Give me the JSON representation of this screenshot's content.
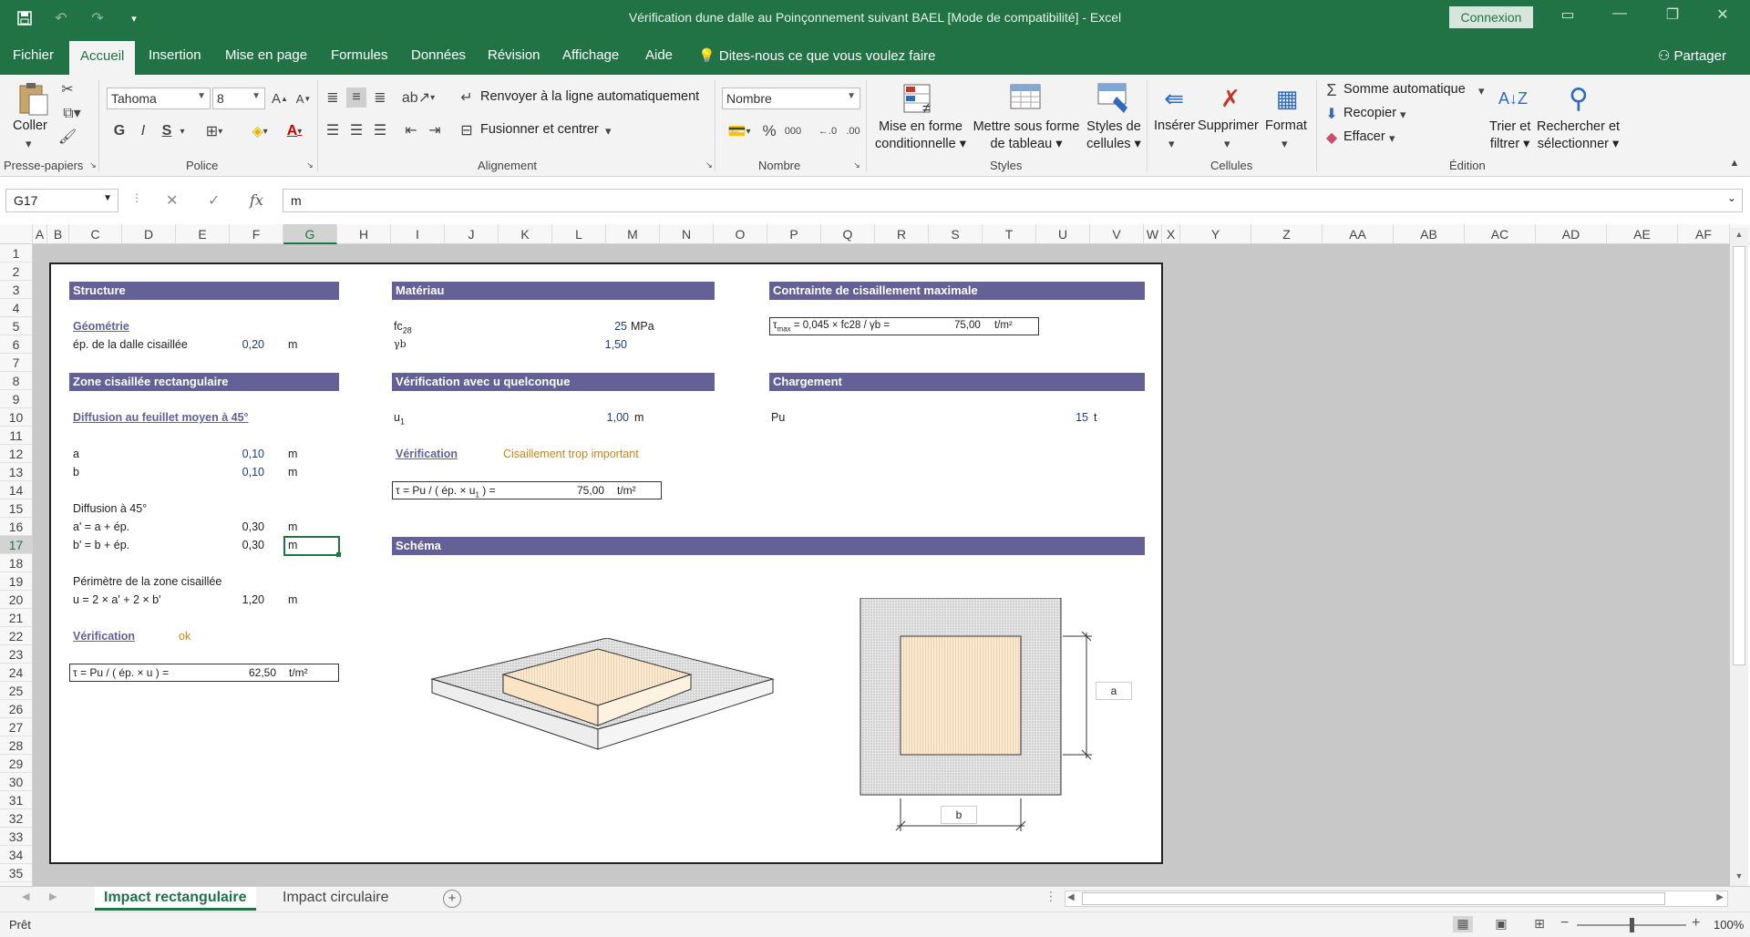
{
  "window": {
    "title": "Vérification dune dalle au Poinçonnement suivant BAEL  [Mode de compatibilité]  -  Excel",
    "signin": "Connexion"
  },
  "menu": {
    "items": [
      "Fichier",
      "Accueil",
      "Insertion",
      "Mise en page",
      "Formules",
      "Données",
      "Révision",
      "Affichage",
      "Aide"
    ],
    "tell_me": "Dites-nous ce que vous voulez faire",
    "share": "Partager"
  },
  "ribbon": {
    "paste": "Coller",
    "font_name": "Tahoma",
    "font_size": "8",
    "bold": "G",
    "italic": "I",
    "underline": "S",
    "wrap_text": "Renvoyer à la ligne automatiquement",
    "merge_center": "Fusionner et centrer",
    "number_format": "Nombre",
    "cond_format": [
      "Mise en forme",
      "conditionnelle"
    ],
    "format_table": [
      "Mettre sous forme",
      "de tableau"
    ],
    "cell_styles": [
      "Styles de",
      "cellules"
    ],
    "insert": "Insérer",
    "delete": "Supprimer",
    "format": "Format",
    "autosum": "Somme automatique",
    "fill": "Recopier",
    "clear": "Effacer",
    "sort_filter": [
      "Trier et",
      "filtrer"
    ],
    "find_select": [
      "Rechercher et",
      "sélectionner"
    ],
    "groups": [
      "Presse-papiers",
      "Police",
      "Alignement",
      "Nombre",
      "Styles",
      "Cellules",
      "Édition"
    ]
  },
  "formula_bar": {
    "name_box": "G17",
    "fx": "fx",
    "content": "m"
  },
  "columns": [
    "A",
    "B",
    "C",
    "D",
    "E",
    "F",
    "G",
    "H",
    "I",
    "J",
    "K",
    "L",
    "M",
    "N",
    "O",
    "P",
    "Q",
    "R",
    "S",
    "T",
    "U",
    "V",
    "W",
    "X",
    "Y",
    "Z",
    "AA",
    "AB",
    "AC",
    "AD",
    "AE",
    "AF"
  ],
  "rows": [
    "1",
    "2",
    "3",
    "4",
    "5",
    "6",
    "7",
    "8",
    "9",
    "10",
    "11",
    "12",
    "13",
    "14",
    "15",
    "16",
    "17",
    "18",
    "19",
    "20",
    "21",
    "22",
    "23",
    "24",
    "25",
    "26",
    "27",
    "28",
    "29",
    "30",
    "31",
    "32",
    "33",
    "34",
    "35"
  ],
  "sheet": {
    "structure": {
      "header": "Structure",
      "geometry_link": "Géométrie",
      "thickness_label": "ép. de la dalle cisaillée",
      "thickness_value": "0,20",
      "thickness_unit": "m"
    },
    "zone": {
      "header": "Zone cisaillée rectangulaire",
      "diffusion_link": "Diffusion au feuillet moyen à 45°",
      "a_label": "a",
      "a_value": "0,10",
      "a_unit": "m",
      "b_label": "b",
      "b_value": "0,10",
      "b_unit": "m",
      "diff45": "Diffusion à 45°",
      "a2_label": "a' = a + ép.",
      "a2_value": "0,30",
      "a2_unit": "m",
      "b2_label": "b' = b + ép.",
      "b2_value": "0,30",
      "b2_unit": "m",
      "perimeter_label": "Périmètre de la zone cisaillée",
      "u_label": "u = 2 × a' + 2 × b'",
      "u_value": "1,20",
      "u_unit": "m",
      "verif_link": "Vérification",
      "verif_result": "ok",
      "tau_formula": "τ = Pu / ( ép. × u ) =",
      "tau_value": "62,50",
      "tau_unit": "t/m²"
    },
    "material": {
      "header": "Matériau",
      "fc_label": "fc",
      "fc_sub": "28",
      "fc_value": "25",
      "fc_unit": "MPa",
      "gamma_label": "γb",
      "gamma_value": "1,50"
    },
    "u_any": {
      "header": "Vérification avec u quelconque",
      "u1_label": "u",
      "u1_sub": "1",
      "u1_value": "1,00",
      "u1_unit": "m",
      "verif_link": "Vérification",
      "verif_result": "Cisaillement trop important",
      "tau_formula_a": "τ = Pu / ( ép. × u",
      "tau_formula_sub": "1",
      "tau_formula_b": " ) =",
      "tau_value": "75,00",
      "tau_unit": "t/m²"
    },
    "max_shear": {
      "header": "Contrainte de cisaillement maximale",
      "formula_a": "τ",
      "formula_sub": "max",
      "formula_b": " = 0,045 × fc28 / γb =",
      "value": "75,00",
      "unit": "t/m²"
    },
    "loading": {
      "header": "Chargement",
      "pu_label": "Pu",
      "pu_value": "15",
      "pu_unit": "t"
    },
    "schema": {
      "header": "Schéma",
      "dim_a": "a",
      "dim_b": "b"
    }
  },
  "tabs": [
    "Impact rectangulaire",
    "Impact circulaire"
  ],
  "status": {
    "ready": "Prêt",
    "zoom": "100%"
  }
}
